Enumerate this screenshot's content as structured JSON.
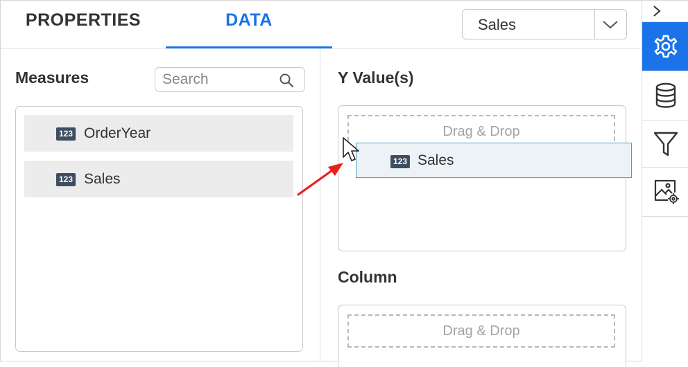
{
  "tabs": [
    {
      "label": "PROPERTIES",
      "active": false
    },
    {
      "label": "DATA",
      "active": true
    }
  ],
  "widget_select": {
    "value": "Sales"
  },
  "measures": {
    "title": "Measures",
    "search_placeholder": "Search",
    "items": [
      {
        "type_badge": "123",
        "label": "OrderYear"
      },
      {
        "type_badge": "123",
        "label": "Sales"
      }
    ]
  },
  "y_values": {
    "title": "Y Value(s)",
    "drop_hint": "Drag & Drop"
  },
  "column": {
    "title": "Column",
    "drop_hint": "Drag & Drop"
  },
  "drag_ghost": {
    "type_badge": "123",
    "label": "Sales"
  },
  "side_toolbar": {
    "items": [
      "chevron-right-icon",
      "gear-icon",
      "database-icon",
      "filter-icon",
      "image-settings-icon"
    ],
    "active": "gear-icon"
  },
  "colors": {
    "accent": "#1a73e8",
    "badge": "#3f4d60",
    "annotation_arrow": "#e8221b",
    "item_background": "#ececec",
    "drag_ghost_border": "#4d9fbf"
  }
}
